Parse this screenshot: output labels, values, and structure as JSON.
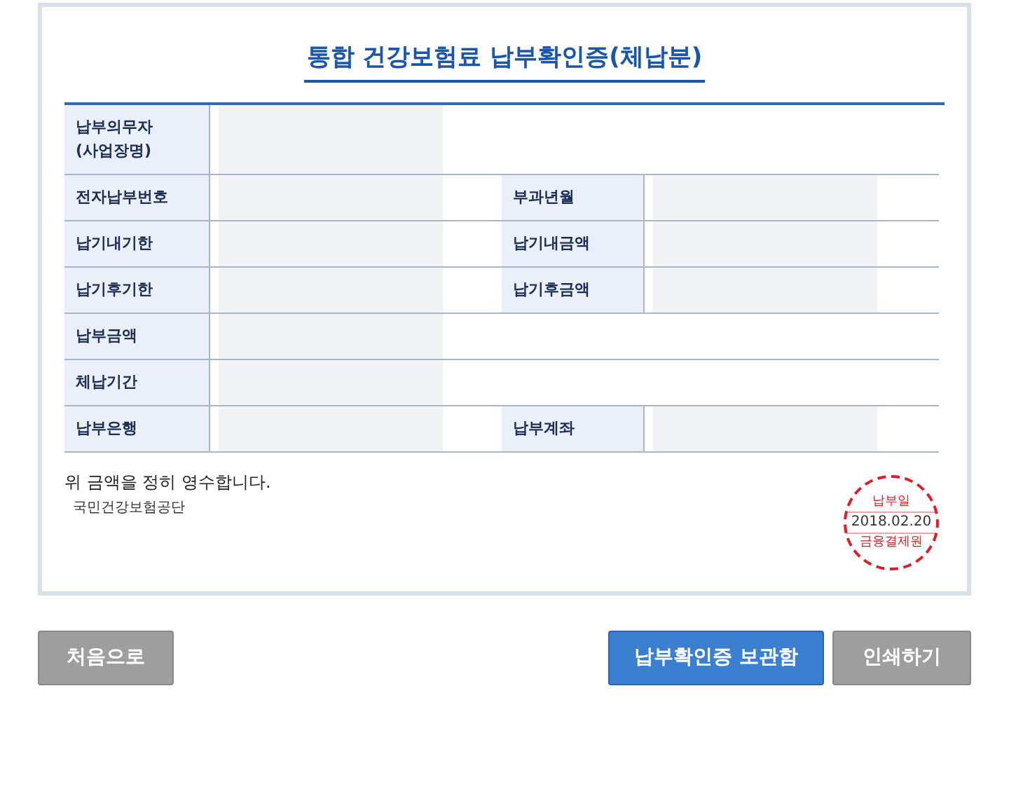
{
  "title": "통합 건강보험료 납부확인증(체납분)",
  "rows": [
    {
      "kind": "wide",
      "labels": [
        "납부의무자\n(사업장명)"
      ]
    },
    {
      "kind": "pair",
      "labels": [
        "전자납부번호",
        "부과년월"
      ]
    },
    {
      "kind": "pair",
      "labels": [
        "납기내기한",
        "납기내금액"
      ]
    },
    {
      "kind": "pair",
      "labels": [
        "납기후기한",
        "납기후금액"
      ]
    },
    {
      "kind": "wide",
      "labels": [
        "납부금액"
      ]
    },
    {
      "kind": "wide",
      "labels": [
        "체납기간"
      ]
    },
    {
      "kind": "pair",
      "labels": [
        "납부은행",
        "납부계좌"
      ]
    }
  ],
  "receipt_text": "위 금액을 정히 영수합니다.",
  "issuer": "국민건강보험공단",
  "stamp": {
    "top": "납부일",
    "date": "2018.02.20",
    "bottom": "금융결제원"
  },
  "buttons": [
    {
      "label": "처음으로",
      "kind": "secondary"
    },
    {
      "label": "납부확인증 보관함",
      "kind": "primary"
    },
    {
      "label": "인쇄하기",
      "kind": "secondary"
    }
  ]
}
